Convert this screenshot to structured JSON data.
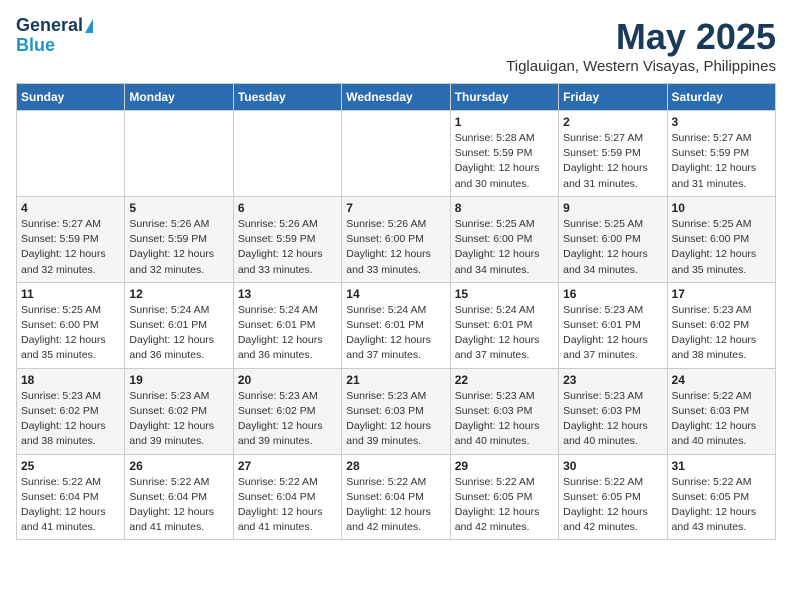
{
  "logo": {
    "line1": "General",
    "line2": "Blue"
  },
  "title": "May 2025",
  "location": "Tiglauigan, Western Visayas, Philippines",
  "weekdays": [
    "Sunday",
    "Monday",
    "Tuesday",
    "Wednesday",
    "Thursday",
    "Friday",
    "Saturday"
  ],
  "weeks": [
    [
      {
        "day": "",
        "info": ""
      },
      {
        "day": "",
        "info": ""
      },
      {
        "day": "",
        "info": ""
      },
      {
        "day": "",
        "info": ""
      },
      {
        "day": "1",
        "info": "Sunrise: 5:28 AM\nSunset: 5:59 PM\nDaylight: 12 hours\nand 30 minutes."
      },
      {
        "day": "2",
        "info": "Sunrise: 5:27 AM\nSunset: 5:59 PM\nDaylight: 12 hours\nand 31 minutes."
      },
      {
        "day": "3",
        "info": "Sunrise: 5:27 AM\nSunset: 5:59 PM\nDaylight: 12 hours\nand 31 minutes."
      }
    ],
    [
      {
        "day": "4",
        "info": "Sunrise: 5:27 AM\nSunset: 5:59 PM\nDaylight: 12 hours\nand 32 minutes."
      },
      {
        "day": "5",
        "info": "Sunrise: 5:26 AM\nSunset: 5:59 PM\nDaylight: 12 hours\nand 32 minutes."
      },
      {
        "day": "6",
        "info": "Sunrise: 5:26 AM\nSunset: 5:59 PM\nDaylight: 12 hours\nand 33 minutes."
      },
      {
        "day": "7",
        "info": "Sunrise: 5:26 AM\nSunset: 6:00 PM\nDaylight: 12 hours\nand 33 minutes."
      },
      {
        "day": "8",
        "info": "Sunrise: 5:25 AM\nSunset: 6:00 PM\nDaylight: 12 hours\nand 34 minutes."
      },
      {
        "day": "9",
        "info": "Sunrise: 5:25 AM\nSunset: 6:00 PM\nDaylight: 12 hours\nand 34 minutes."
      },
      {
        "day": "10",
        "info": "Sunrise: 5:25 AM\nSunset: 6:00 PM\nDaylight: 12 hours\nand 35 minutes."
      }
    ],
    [
      {
        "day": "11",
        "info": "Sunrise: 5:25 AM\nSunset: 6:00 PM\nDaylight: 12 hours\nand 35 minutes."
      },
      {
        "day": "12",
        "info": "Sunrise: 5:24 AM\nSunset: 6:01 PM\nDaylight: 12 hours\nand 36 minutes."
      },
      {
        "day": "13",
        "info": "Sunrise: 5:24 AM\nSunset: 6:01 PM\nDaylight: 12 hours\nand 36 minutes."
      },
      {
        "day": "14",
        "info": "Sunrise: 5:24 AM\nSunset: 6:01 PM\nDaylight: 12 hours\nand 37 minutes."
      },
      {
        "day": "15",
        "info": "Sunrise: 5:24 AM\nSunset: 6:01 PM\nDaylight: 12 hours\nand 37 minutes."
      },
      {
        "day": "16",
        "info": "Sunrise: 5:23 AM\nSunset: 6:01 PM\nDaylight: 12 hours\nand 37 minutes."
      },
      {
        "day": "17",
        "info": "Sunrise: 5:23 AM\nSunset: 6:02 PM\nDaylight: 12 hours\nand 38 minutes."
      }
    ],
    [
      {
        "day": "18",
        "info": "Sunrise: 5:23 AM\nSunset: 6:02 PM\nDaylight: 12 hours\nand 38 minutes."
      },
      {
        "day": "19",
        "info": "Sunrise: 5:23 AM\nSunset: 6:02 PM\nDaylight: 12 hours\nand 39 minutes."
      },
      {
        "day": "20",
        "info": "Sunrise: 5:23 AM\nSunset: 6:02 PM\nDaylight: 12 hours\nand 39 minutes."
      },
      {
        "day": "21",
        "info": "Sunrise: 5:23 AM\nSunset: 6:03 PM\nDaylight: 12 hours\nand 39 minutes."
      },
      {
        "day": "22",
        "info": "Sunrise: 5:23 AM\nSunset: 6:03 PM\nDaylight: 12 hours\nand 40 minutes."
      },
      {
        "day": "23",
        "info": "Sunrise: 5:23 AM\nSunset: 6:03 PM\nDaylight: 12 hours\nand 40 minutes."
      },
      {
        "day": "24",
        "info": "Sunrise: 5:22 AM\nSunset: 6:03 PM\nDaylight: 12 hours\nand 40 minutes."
      }
    ],
    [
      {
        "day": "25",
        "info": "Sunrise: 5:22 AM\nSunset: 6:04 PM\nDaylight: 12 hours\nand 41 minutes."
      },
      {
        "day": "26",
        "info": "Sunrise: 5:22 AM\nSunset: 6:04 PM\nDaylight: 12 hours\nand 41 minutes."
      },
      {
        "day": "27",
        "info": "Sunrise: 5:22 AM\nSunset: 6:04 PM\nDaylight: 12 hours\nand 41 minutes."
      },
      {
        "day": "28",
        "info": "Sunrise: 5:22 AM\nSunset: 6:04 PM\nDaylight: 12 hours\nand 42 minutes."
      },
      {
        "day": "29",
        "info": "Sunrise: 5:22 AM\nSunset: 6:05 PM\nDaylight: 12 hours\nand 42 minutes."
      },
      {
        "day": "30",
        "info": "Sunrise: 5:22 AM\nSunset: 6:05 PM\nDaylight: 12 hours\nand 42 minutes."
      },
      {
        "day": "31",
        "info": "Sunrise: 5:22 AM\nSunset: 6:05 PM\nDaylight: 12 hours\nand 43 minutes."
      }
    ]
  ]
}
